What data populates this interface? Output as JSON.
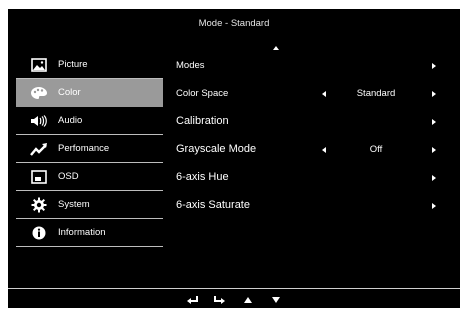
{
  "osd": {
    "title": "Mode - Standard",
    "sidebar": {
      "items": [
        {
          "label": "Picture",
          "icon": "picture-icon"
        },
        {
          "label": "Color",
          "icon": "palette-icon",
          "active": true
        },
        {
          "label": "Audio",
          "icon": "speaker-icon"
        },
        {
          "label": "Perfomance",
          "icon": "performance-icon"
        },
        {
          "label": "OSD",
          "icon": "osd-icon"
        },
        {
          "label": "System",
          "icon": "gear-icon"
        },
        {
          "label": "Information",
          "icon": "info-icon"
        }
      ]
    },
    "content": {
      "rows": [
        {
          "label": "Modes",
          "value": ""
        },
        {
          "label": "Color Space",
          "value": "Standard"
        },
        {
          "label": "Calibration",
          "value": ""
        },
        {
          "label": "Grayscale Mode",
          "value": "Off"
        },
        {
          "label": "6-axis Hue",
          "value": ""
        },
        {
          "label": "6-axis Saturate",
          "value": ""
        }
      ]
    },
    "footer_icons": [
      "back-icon",
      "enter-icon",
      "up-icon",
      "down-icon"
    ],
    "colors": {
      "background": "#000000",
      "active_item": "#9a9a9a",
      "text": "#ffffff"
    }
  }
}
